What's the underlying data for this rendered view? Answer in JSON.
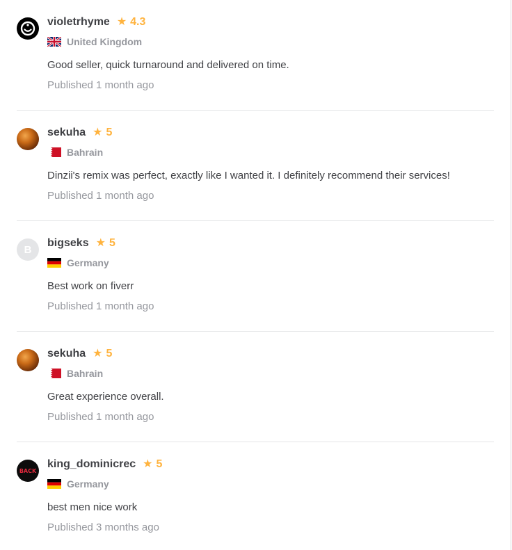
{
  "reviews": [
    {
      "username": "violetrhyme",
      "rating": "4.3",
      "country": "United Kingdom",
      "flag": "uk",
      "avatar_type": "black",
      "text": "Good seller, quick turnaround and delivered on time.",
      "published": "Published 1 month ago"
    },
    {
      "username": "sekuha",
      "rating": "5",
      "country": "Bahrain",
      "flag": "bahrain",
      "avatar_type": "orb",
      "text": "Dinzii's remix was perfect, exactly like I wanted it. I definitely recommend their services!",
      "published": "Published 1 month ago"
    },
    {
      "username": "bigseks",
      "rating": "5",
      "country": "Germany",
      "flag": "germany",
      "avatar_type": "letter",
      "avatar_letter": "B",
      "text": "Best work on fiverr",
      "published": "Published 1 month ago"
    },
    {
      "username": "sekuha",
      "rating": "5",
      "country": "Bahrain",
      "flag": "bahrain",
      "avatar_type": "orb",
      "text": "Great experience overall.",
      "published": "Published 1 month ago"
    },
    {
      "username": "king_dominicrec",
      "rating": "5",
      "country": "Germany",
      "flag": "germany",
      "avatar_type": "back",
      "avatar_logo_text": "BACK",
      "text": "best men nice work",
      "published": "Published 3 months ago"
    }
  ],
  "colors": {
    "star": "#ffb33e",
    "username": "#404145",
    "muted": "#95979d",
    "divider": "#e4e5e7"
  },
  "icons": {
    "rating": "star-icon",
    "country": "flag-icon"
  }
}
